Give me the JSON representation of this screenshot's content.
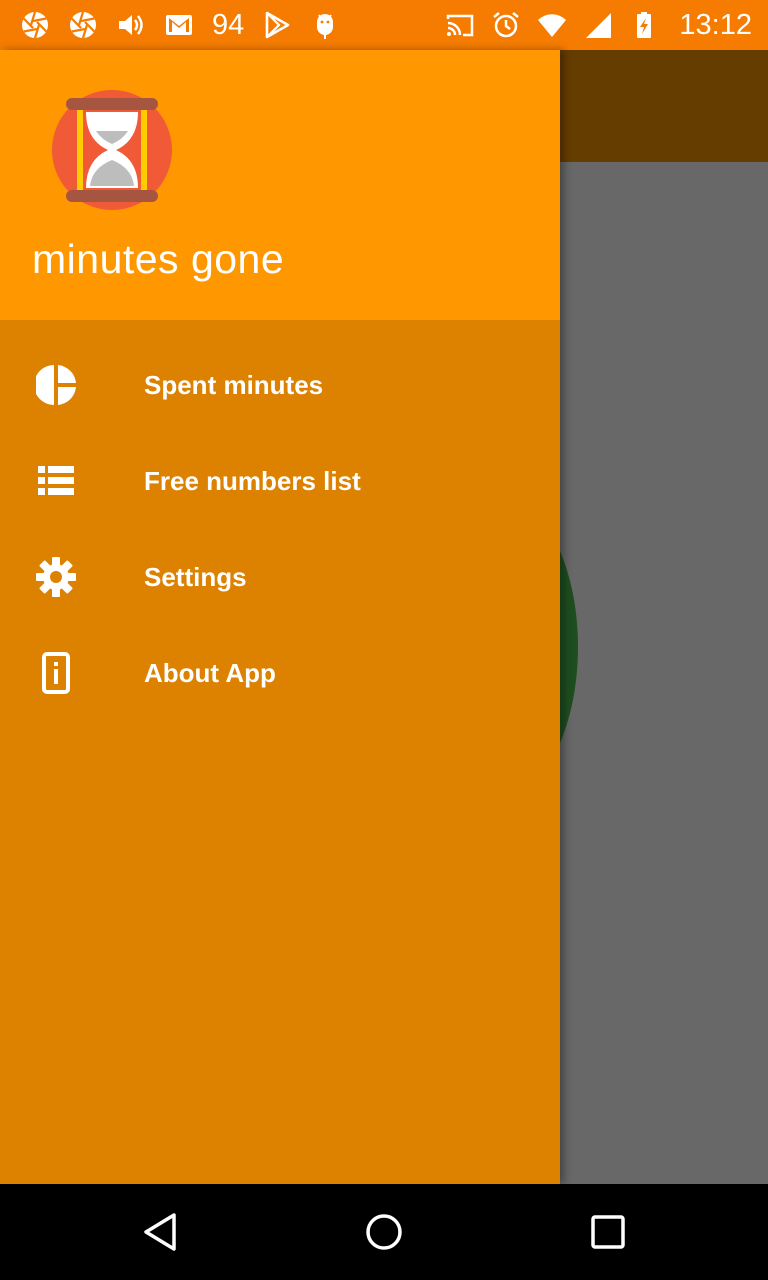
{
  "status_bar": {
    "left_icons": [
      "aperture-icon",
      "aperture-icon",
      "volume-icon",
      "gmail-icon"
    ],
    "notification_count": "94",
    "extra_icons": [
      "play-store-icon",
      "android-debug-icon"
    ],
    "right_icons": [
      "cast-icon",
      "alarm-icon",
      "wifi-icon",
      "signal-icon",
      "battery-charging-icon"
    ],
    "time": "13:12",
    "color": "#f57c00"
  },
  "drawer": {
    "header_color": "#ff9800",
    "body_color": "#dc8100",
    "logo": "hourglass-icon",
    "app_name": "minutes gone",
    "items": [
      {
        "label": "Spent minutes",
        "icon": "pie-chart-icon"
      },
      {
        "label": "Free numbers list",
        "icon": "list-icon"
      },
      {
        "label": "Settings",
        "icon": "gear-icon"
      },
      {
        "label": "About App",
        "icon": "info-icon"
      }
    ]
  },
  "nav_bar": {
    "buttons": [
      "back-icon",
      "home-icon",
      "recents-icon"
    ]
  }
}
